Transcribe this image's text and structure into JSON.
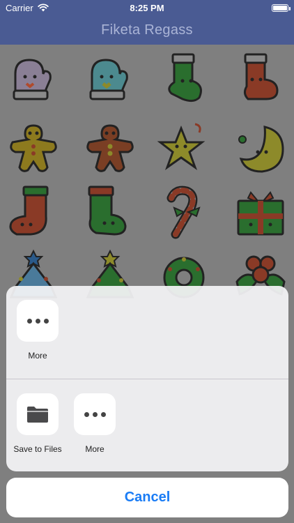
{
  "status_bar": {
    "carrier": "Carrier",
    "time": "8:25 PM"
  },
  "nav": {
    "title": "Fiketa Regass"
  },
  "stickers": [
    {
      "icon": "mitten-purple-icon"
    },
    {
      "icon": "mitten-blue-icon"
    },
    {
      "icon": "stocking-green-icon"
    },
    {
      "icon": "stocking-red-icon"
    },
    {
      "icon": "gingerbread-yellow-icon"
    },
    {
      "icon": "gingerbread-brown-icon"
    },
    {
      "icon": "star-ornament-icon"
    },
    {
      "icon": "moon-ornament-icon"
    },
    {
      "icon": "stocking-red-2-icon"
    },
    {
      "icon": "stocking-green-2-icon"
    },
    {
      "icon": "candy-cane-icon"
    },
    {
      "icon": "gift-box-icon"
    },
    {
      "icon": "christmas-tree-blue-icon"
    },
    {
      "icon": "christmas-tree-green-icon"
    },
    {
      "icon": "wreath-icon"
    },
    {
      "icon": "holly-berries-icon"
    }
  ],
  "share_sheet": {
    "top_row": [
      {
        "label": "More",
        "icon": "more-dots-icon"
      }
    ],
    "bottom_row": [
      {
        "label": "Save to Files",
        "icon": "folder-icon"
      },
      {
        "label": "More",
        "icon": "more-dots-icon"
      }
    ]
  },
  "cancel": {
    "label": "Cancel"
  },
  "colors": {
    "nav_background": "#4a5b93",
    "nav_title": "#aab4d6",
    "cancel_text": "#1a7cf5",
    "dim_overlay": "#7f7f7f"
  }
}
